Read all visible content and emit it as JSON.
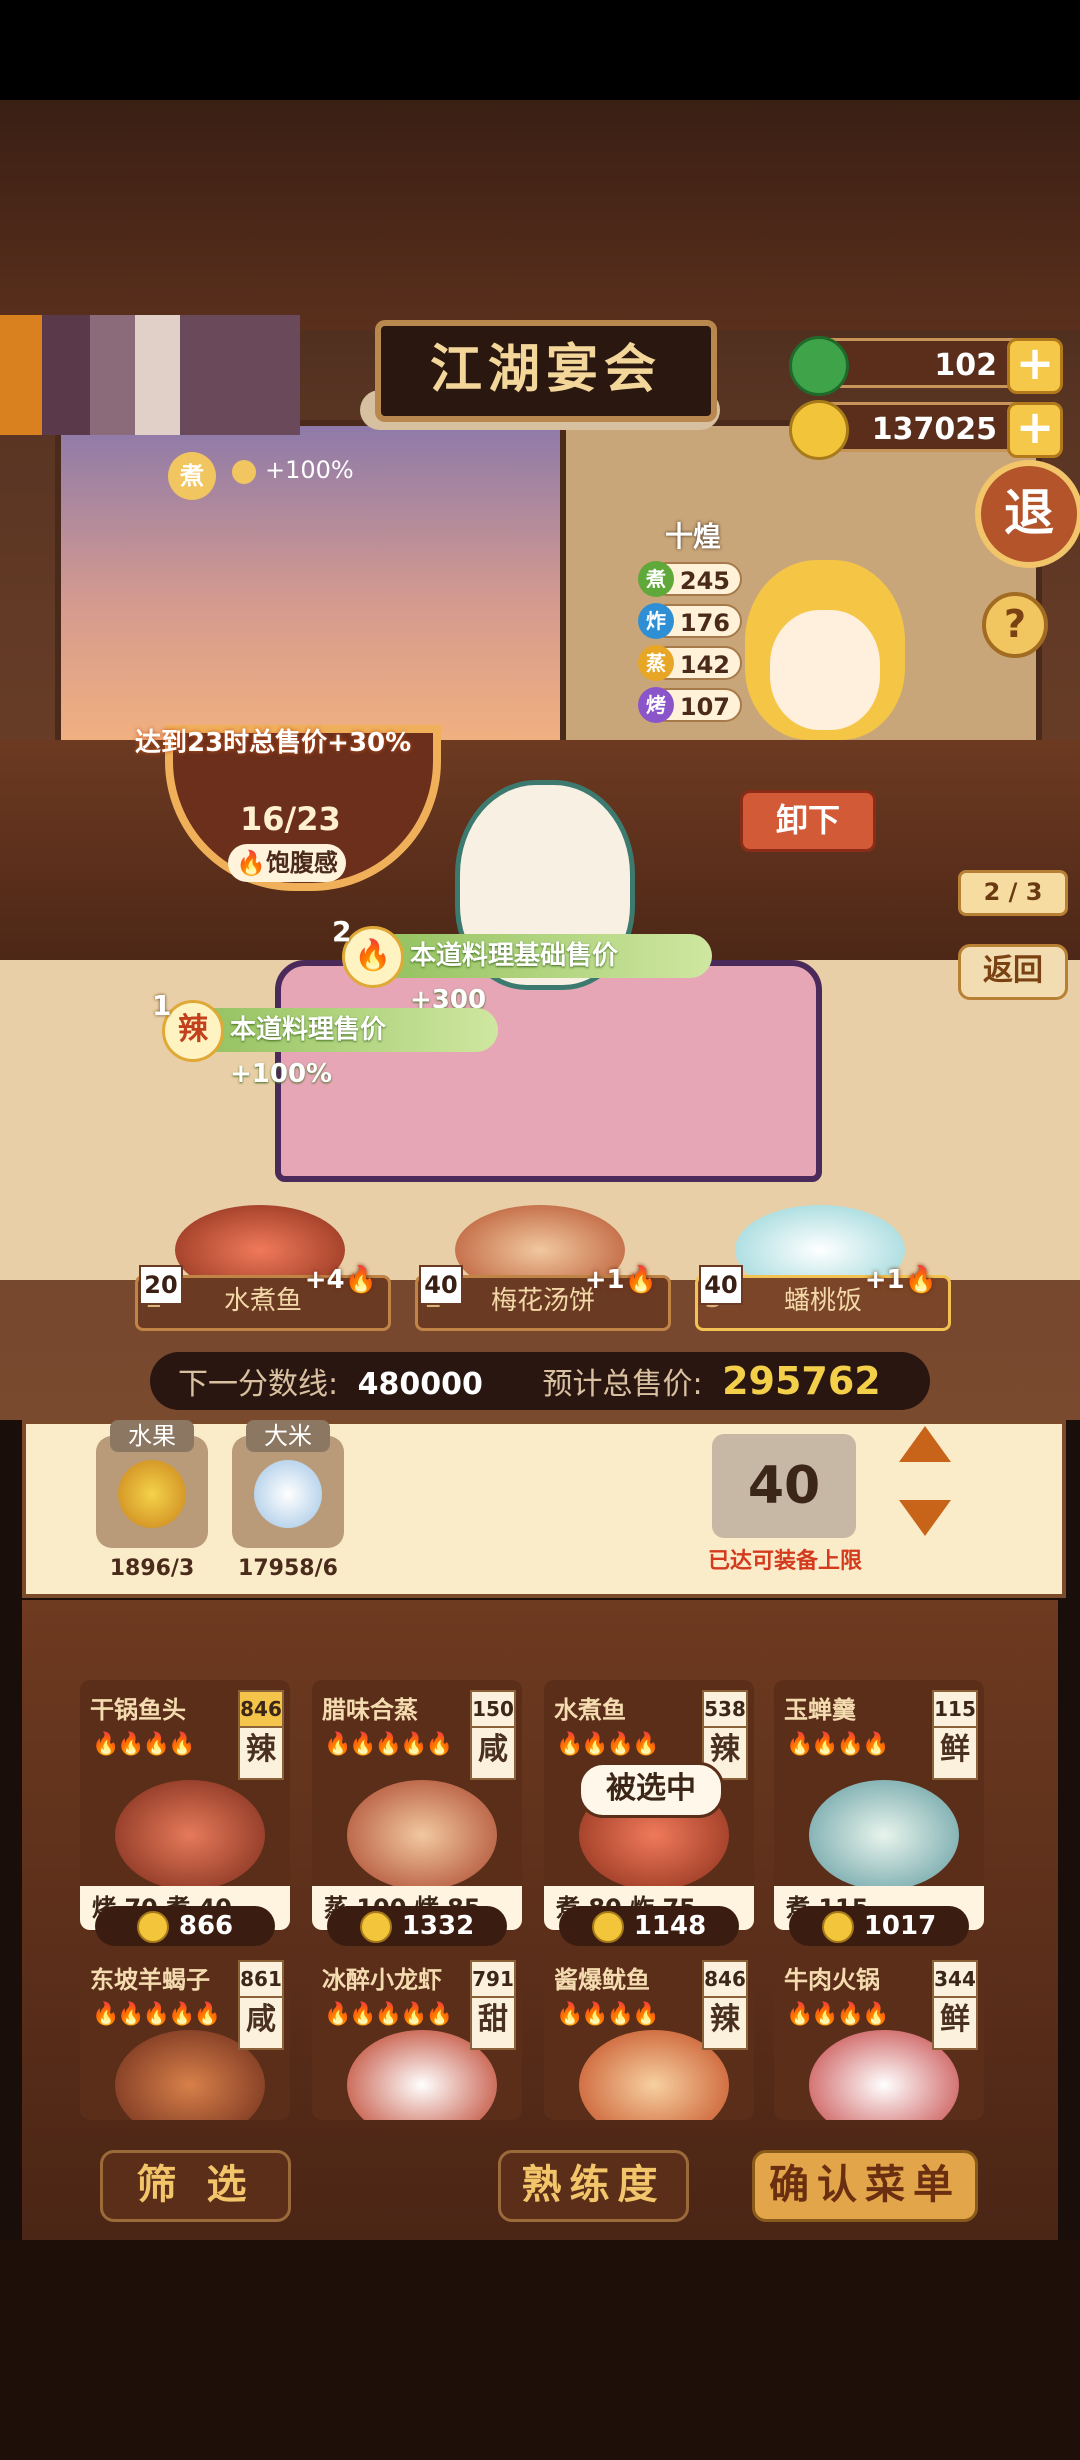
{
  "header": {
    "sign_title": "江湖宴会"
  },
  "currency": {
    "jade": "102",
    "coins": "137025"
  },
  "buttons": {
    "exit": "退",
    "help": "?",
    "unload": "卸下",
    "back": "返回",
    "pager": "2 / 3"
  },
  "chef": {
    "name": "十煌",
    "stats": [
      {
        "skill": "煮",
        "value": "245",
        "color": "#5fa83a"
      },
      {
        "skill": "炸",
        "value": "176",
        "color": "#2f8fd4"
      },
      {
        "skill": "蒸",
        "value": "142",
        "color": "#e7a626"
      },
      {
        "skill": "烤",
        "value": "107",
        "color": "#8a55c9"
      }
    ]
  },
  "partial_bonus": {
    "icon": "煮",
    "text": "+100%"
  },
  "bowl": {
    "bonus": "达到23时总售价+30%",
    "progress": "16/23",
    "label": "饱腹感",
    "progress_value": 0.696
  },
  "buffs": [
    {
      "index": "2",
      "icon": "flame",
      "text": "本道料理基础售价+300"
    },
    {
      "index": "1",
      "icon": "辣",
      "text": "本道料理售价+100%"
    }
  ],
  "slots": [
    {
      "level": "20",
      "bonus": "+4",
      "index": "1",
      "name": "水煮鱼"
    },
    {
      "level": "40",
      "bonus": "+1",
      "index": "2",
      "name": "梅花汤饼"
    },
    {
      "level": "40",
      "bonus": "+1",
      "index": "3",
      "name": "蟠桃饭"
    }
  ],
  "score": {
    "next_label": "下一分数线:",
    "next_value": "480000",
    "total_label": "预计总售价:",
    "total_value": "295762"
  },
  "ingredients": [
    {
      "tag": "水果",
      "amount": "1896/3"
    },
    {
      "tag": "大米",
      "amount": "17958/6"
    }
  ],
  "equip": {
    "count": "40",
    "limit_text": "已达可装备上限"
  },
  "recipes": [
    {
      "name": "干锅鱼头",
      "score": "846",
      "taste": "辣",
      "flames": "🔥🔥🔥🔥",
      "skills": "烤 70   煮 40",
      "price": "866"
    },
    {
      "name": "腊味合蒸",
      "score": "150",
      "taste": "咸",
      "flames": "🔥🔥🔥🔥🔥",
      "skills": "蒸 100  烤 85",
      "price": "1332"
    },
    {
      "name": "水煮鱼",
      "score": "538",
      "taste": "辣",
      "flames": "🔥🔥🔥🔥",
      "skills": "煮 80   炸 75",
      "price": "1148"
    },
    {
      "name": "玉蝉羹",
      "score": "115",
      "taste": "鲜",
      "flames": "🔥🔥🔥🔥",
      "skills": "煮 115",
      "price": "1017"
    },
    {
      "name": "东坡羊蝎子",
      "score": "861",
      "taste": "咸",
      "flames": "🔥🔥🔥🔥🔥",
      "skills": "",
      "price": ""
    },
    {
      "name": "冰醉小龙虾",
      "score": "791",
      "taste": "甜",
      "flames": "🔥🔥🔥🔥🔥",
      "skills": "",
      "price": ""
    },
    {
      "name": "酱爆鱿鱼",
      "score": "846",
      "taste": "辣",
      "flames": "🔥🔥🔥🔥",
      "skills": "",
      "price": ""
    },
    {
      "name": "牛肉火锅",
      "score": "344",
      "taste": "鲜",
      "flames": "🔥🔥🔥🔥",
      "skills": "",
      "price": ""
    }
  ],
  "selected_label": "被选中",
  "bottom_buttons": {
    "filter": "筛 选",
    "mastery": "熟练度",
    "confirm": "确认菜单"
  }
}
